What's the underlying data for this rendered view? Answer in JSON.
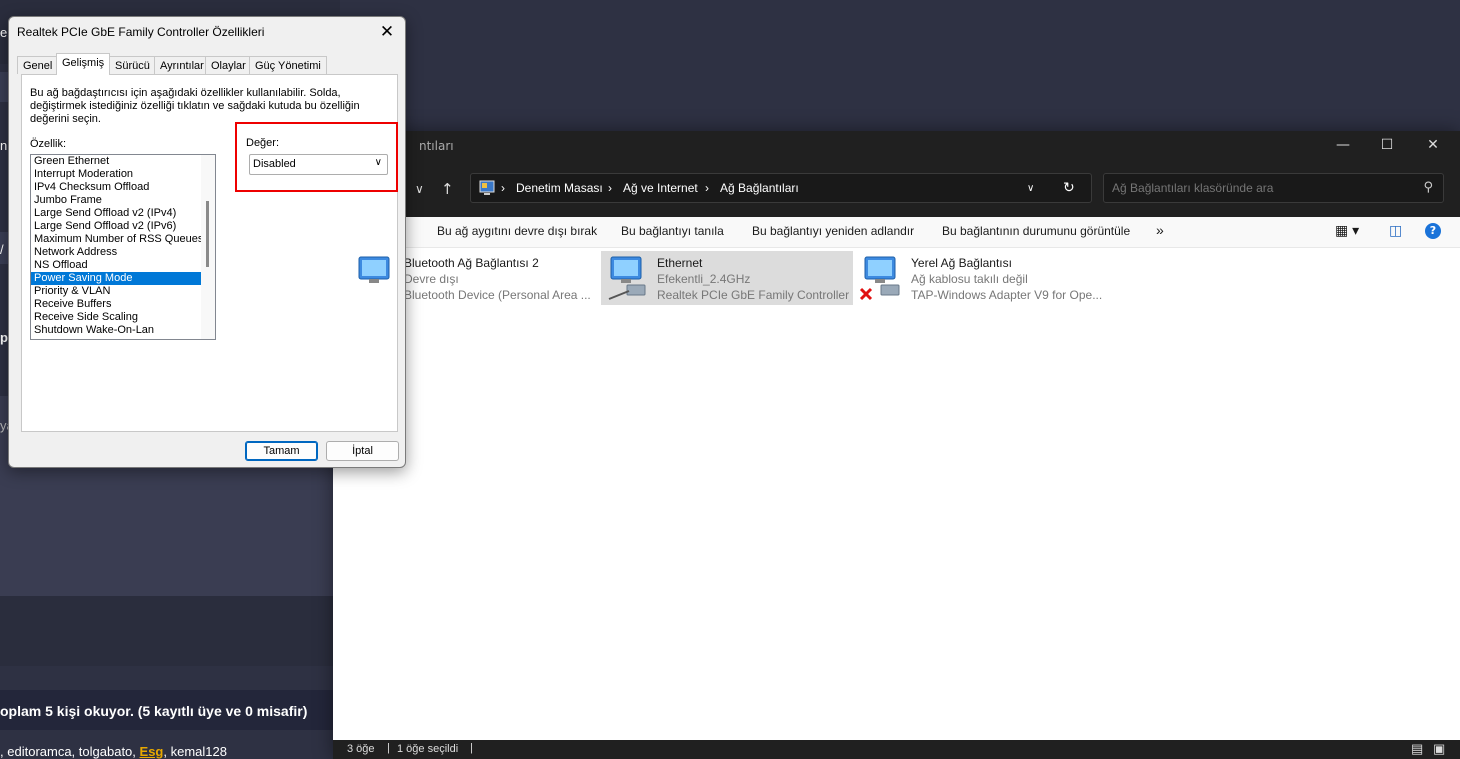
{
  "background": {
    "fragments": [
      "e",
      "n",
      "/",
      "p",
      "ya"
    ],
    "online_text": "oplam 5 kişi okuyor. (5 kayıtlı üye ve 0 misafir)",
    "users": [
      {
        "name": ",",
        "color": "#ffffff"
      },
      {
        "name": "editoramca,",
        "color": "#ffffff"
      },
      {
        "name": "tolgabato,",
        "color": "#ffffff"
      },
      {
        "name": "Esg",
        "color": "#e8a800"
      },
      {
        "name": ",",
        "color": "#ffffff"
      },
      {
        "name": "kemal128",
        "color": "#ffffff"
      }
    ]
  },
  "explorer": {
    "title": "ntıları",
    "breadcrumb": [
      "Denetim Masası",
      "Ağ ve Internet",
      "Ağ Bağlantıları"
    ],
    "search_placeholder": "Ağ Bağlantıları klasöründe ara",
    "commands": [
      "Bu ağ aygıtını devre dışı bırak",
      "Bu bağlantıyı tanıla",
      "Bu bağlantıyı yeniden adlandır",
      "Bu bağlantının durumunu görüntüle"
    ],
    "more": "»",
    "items": [
      {
        "name": "Bluetooth Ağ Bağlantısı 2",
        "status": "Devre dışı",
        "device": "Bluetooth Device (Personal Area ...",
        "selected": false,
        "disconnected": false
      },
      {
        "name": "Ethernet",
        "status": "Efekentli_2.4GHz",
        "device": "Realtek PCIe GbE Family Controller",
        "selected": true,
        "disconnected": false
      },
      {
        "name": "Yerel Ağ Bağlantısı",
        "status": "Ağ kablosu takılı değil",
        "device": "TAP-Windows Adapter V9 for Ope...",
        "selected": false,
        "disconnected": true
      }
    ],
    "status_count": "3 öğe",
    "status_selected": "1 öğe seçildi"
  },
  "dialog": {
    "title": "Realtek PCIe GbE Family Controller Özellikleri",
    "tabs": [
      "Genel",
      "Gelişmiş",
      "Sürücü",
      "Ayrıntılar",
      "Olaylar",
      "Güç Yönetimi"
    ],
    "active_tab": "Gelişmiş",
    "description": "Bu ağ bağdaştırıcısı için aşağıdaki özellikler kullanılabilir. Solda, değiştirmek istediğiniz özelliği tıklatın ve sağdaki kutuda bu özelliğin değerini seçin.",
    "property_label": "Özellik:",
    "properties": [
      "Green Ethernet",
      "Interrupt Moderation",
      "IPv4 Checksum Offload",
      "Jumbo Frame",
      "Large Send Offload v2 (IPv4)",
      "Large Send Offload v2 (IPv6)",
      "Maximum Number of RSS Queues",
      "Network Address",
      "NS Offload",
      "Power Saving Mode",
      "Priority & VLAN",
      "Receive Buffers",
      "Receive Side Scaling",
      "Shutdown Wake-On-Lan"
    ],
    "selected_property": "Power Saving Mode",
    "value_label": "Değer:",
    "value": "Disabled",
    "ok_label": "Tamam",
    "cancel_label": "İptal"
  }
}
